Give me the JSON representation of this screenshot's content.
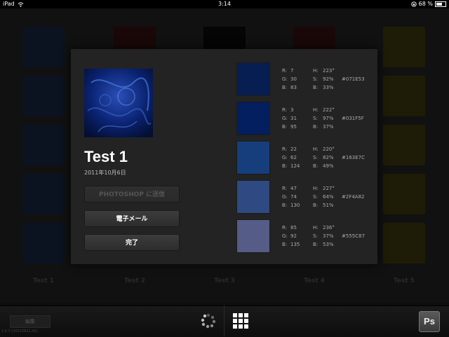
{
  "statusbar": {
    "device": "iPad",
    "time": "3:14",
    "battery": "68 %",
    "battery_fraction": 0.68
  },
  "background": {
    "columns": [
      {
        "label": "Test 1",
        "color": "#0b1320"
      },
      {
        "label": "Test 2",
        "color": "#1a0808"
      },
      {
        "label": "Test 3",
        "color": "#050505"
      },
      {
        "label": "Test 4",
        "color": "#1a0808"
      },
      {
        "label": "Test 5",
        "color": "#1e1c06"
      }
    ]
  },
  "dialog": {
    "title": "Test 1",
    "date": "2011年10月6日",
    "buttons": {
      "photoshop": "PHOTOSHOP に送信",
      "email": "電子メール",
      "done": "完了"
    },
    "swatches": [
      {
        "hex": "#071E53",
        "r": "7",
        "g": "30",
        "b": "83",
        "h": "223°",
        "s": "92%",
        "v": "33%"
      },
      {
        "hex": "#031F5F",
        "r": "3",
        "g": "31",
        "b": "95",
        "h": "222°",
        "s": "97%",
        "v": "37%"
      },
      {
        "hex": "#163E7C",
        "r": "22",
        "g": "62",
        "b": "124",
        "h": "220°",
        "s": "82%",
        "v": "49%"
      },
      {
        "hex": "#2F4A82",
        "r": "47",
        "g": "74",
        "b": "130",
        "h": "227°",
        "s": "64%",
        "v": "51%"
      },
      {
        "hex": "#555C87",
        "r": "85",
        "g": "92",
        "b": "135",
        "h": "236°",
        "s": "37%",
        "v": "53%"
      }
    ]
  },
  "toolbar": {
    "edit_label": "編集",
    "version": "1.0.3 (20110822.41)",
    "ps_label": "Ps",
    "icons": [
      "spinner-icon",
      "grid-icon",
      "photoshop-icon"
    ]
  }
}
